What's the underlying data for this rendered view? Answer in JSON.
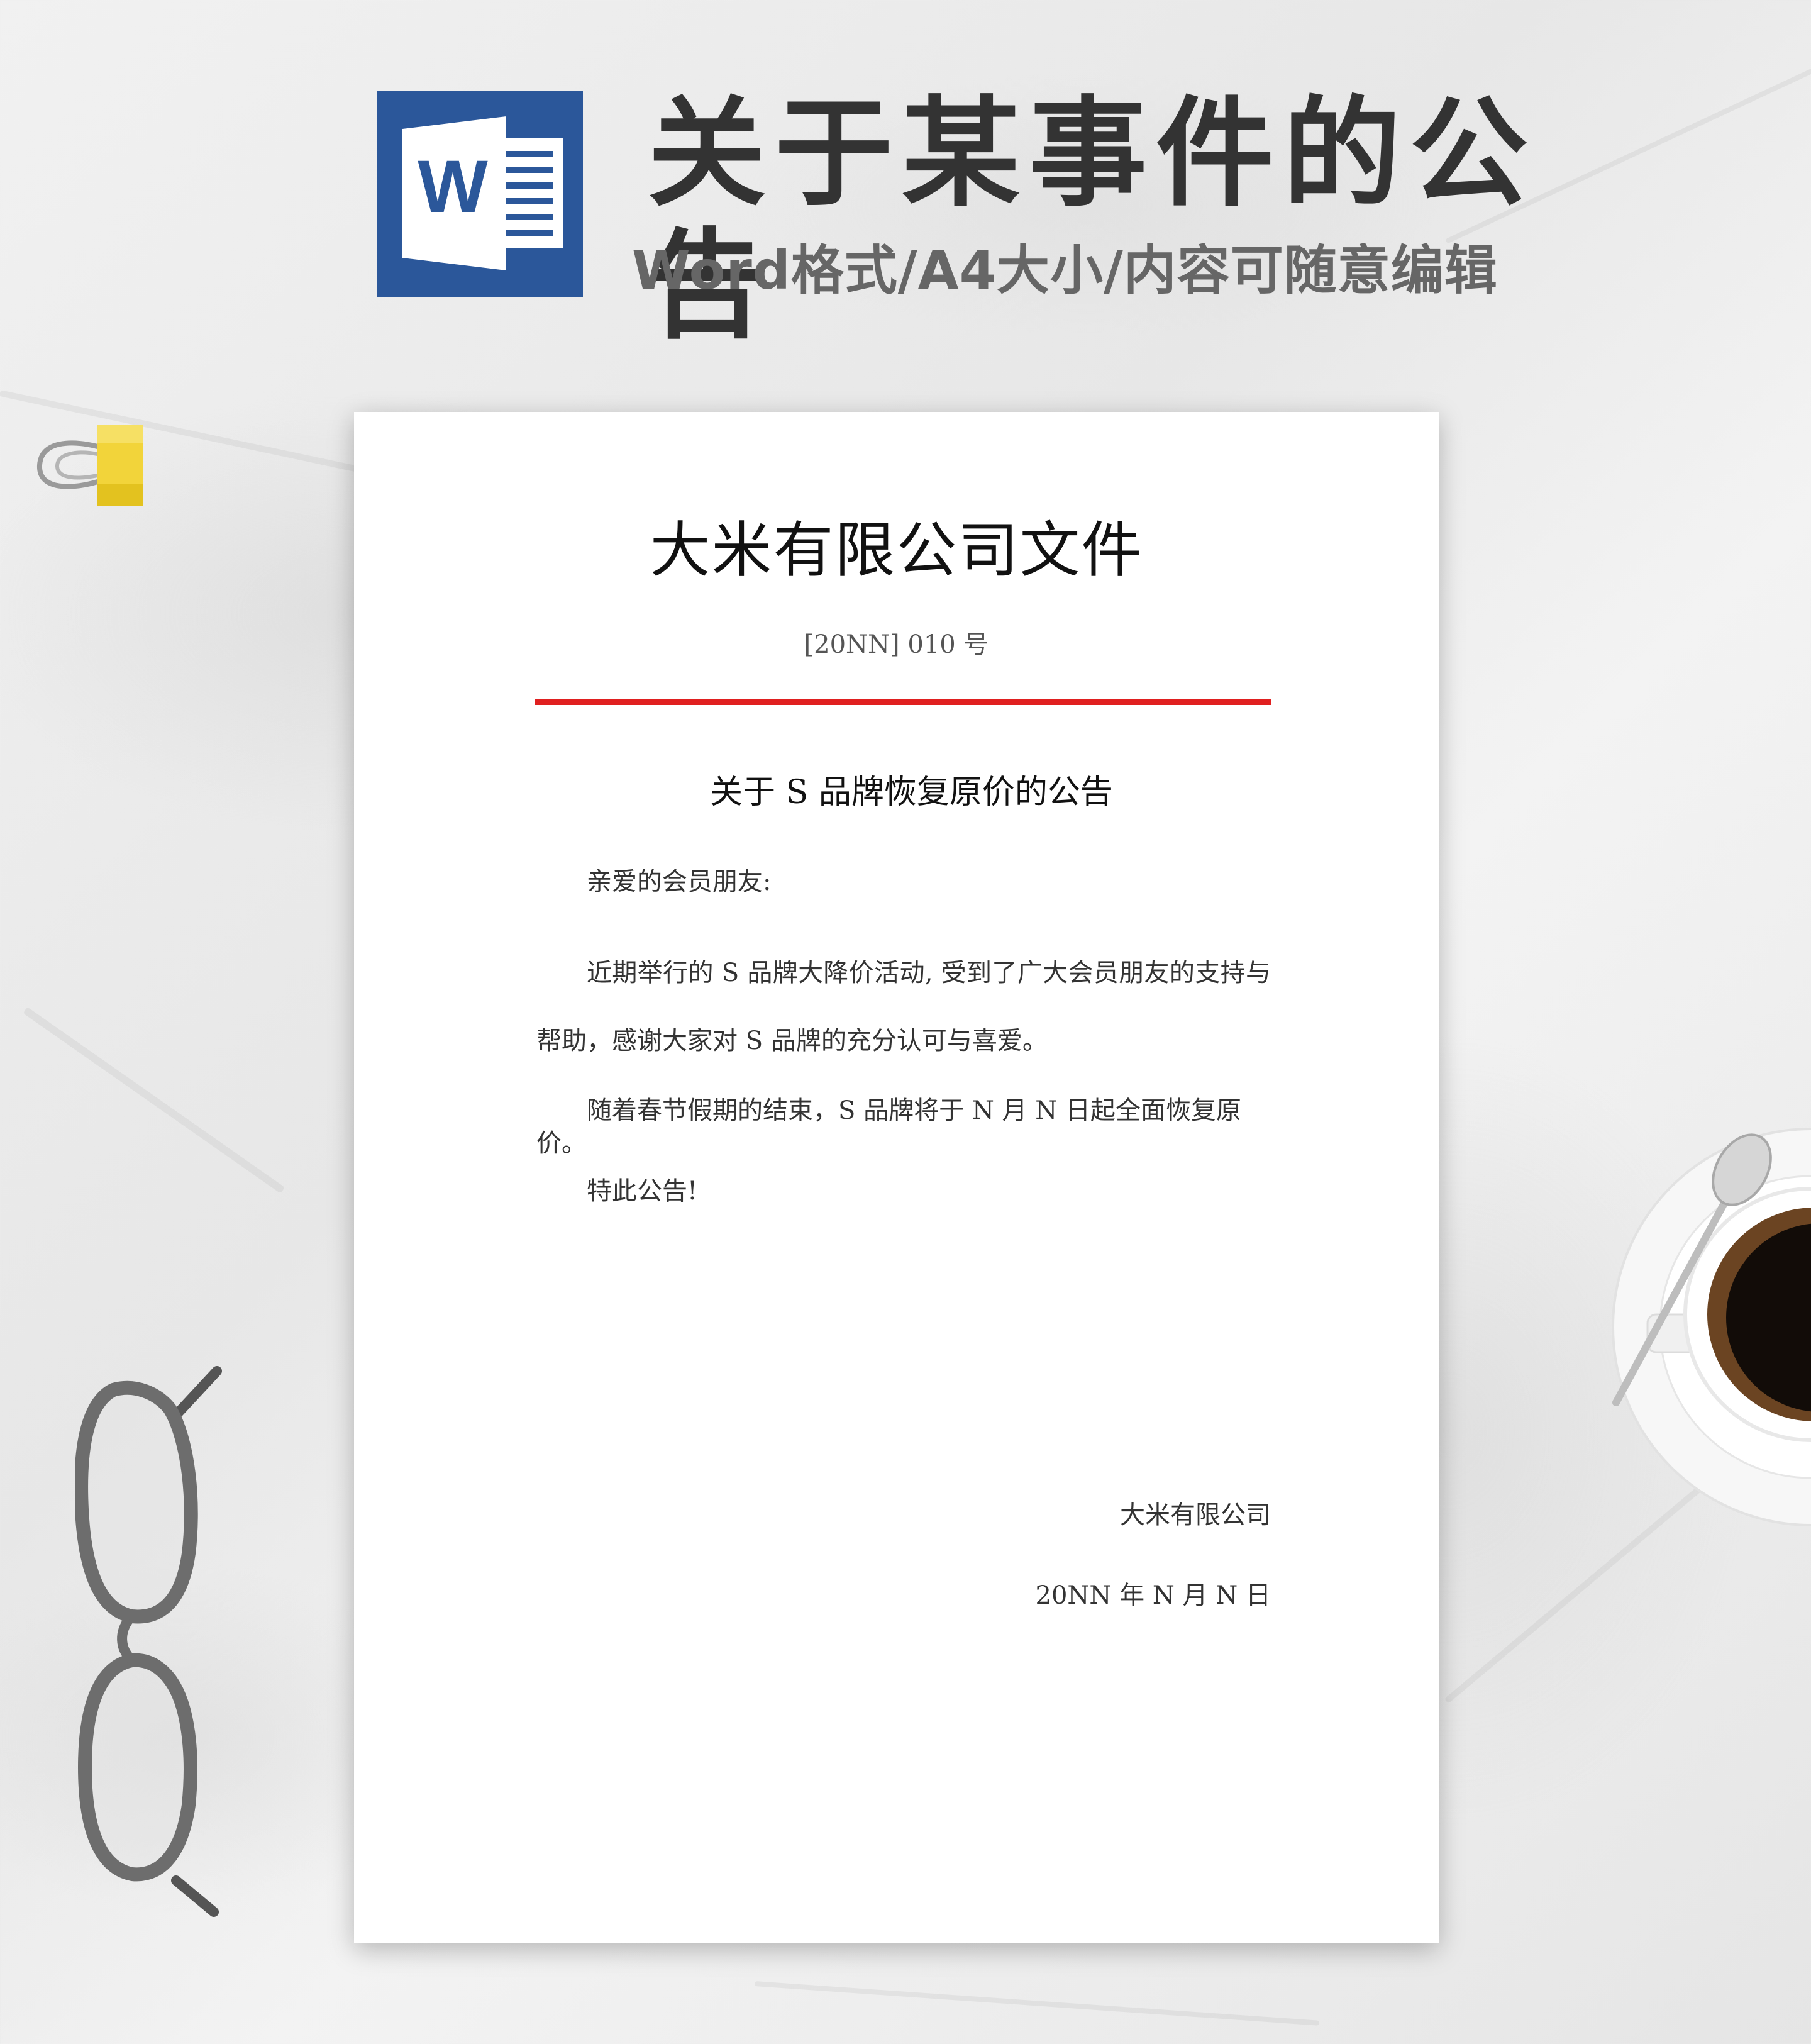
{
  "banner": {
    "title": "关于某事件的公告",
    "subtitle": "Word格式/A4大小/内容可随意编辑",
    "logo_letter": "W",
    "logo_color": "#2b579a"
  },
  "document": {
    "header": "大米有限公司文件",
    "number": "[20NN] 010 号",
    "rule_color": "#e02020",
    "notice_title": "关于 S 品牌恢复原价的公告",
    "salutation": "亲爱的会员朋友:",
    "paragraph1": "近期举行的 S 品牌大降价活动, 受到了广大会员朋友的支持与帮助，感谢大家对 S 品牌的充分认可与喜爱。",
    "paragraph2": "随着春节假期的结束，S 品牌将于 N 月 N 日起全面恢复原价。",
    "closing": "特此公告!",
    "signature_company": "大米有限公司",
    "signature_date": "20NN 年 N 月 N 日"
  },
  "decor": {
    "clip_icon": "binder-clip-icon",
    "glasses_icon": "eyeglasses-icon",
    "coffee_icon": "coffee-cup-icon"
  }
}
